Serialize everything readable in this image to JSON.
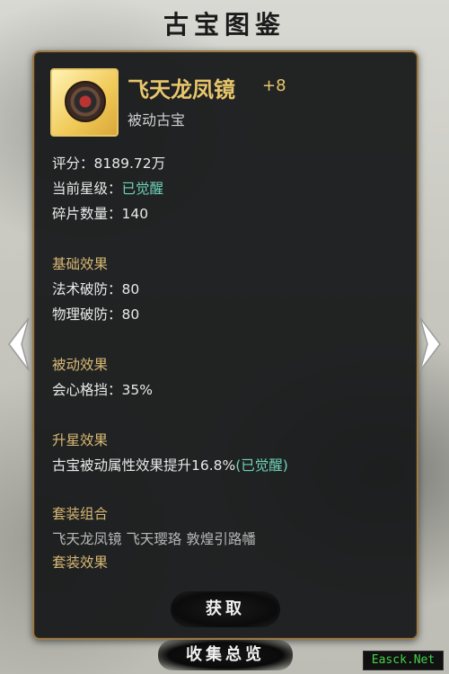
{
  "header": {
    "title": "古宝图鉴"
  },
  "item": {
    "name": "飞天龙凤镜",
    "level": "+8",
    "type": "被动古宝"
  },
  "stats": {
    "rating_label": "评分：",
    "rating_value": "8189.72万",
    "star_label": "当前星级：",
    "star_value": "已觉醒",
    "fragments_label": "碎片数量：",
    "fragments_value": "140"
  },
  "sections": {
    "base_title": "基础效果",
    "base_lines": [
      "法术破防：80",
      "物理破防：80"
    ],
    "passive_title": "被动效果",
    "passive_lines": [
      "会心格挡：35%"
    ],
    "upgrade_title": "升星效果",
    "upgrade_text": "古宝被动属性效果提升16.8%",
    "upgrade_tag": "(已觉醒)",
    "set_title": "套装组合",
    "set_items": "飞天龙凤镜 飞天璎珞 敦煌引路幡",
    "set_effect_title": "套装效果"
  },
  "buttons": {
    "get": "获取",
    "collection_overview": "收集总览"
  },
  "watermark": "Easck.Net",
  "colors": {
    "gold": "#e8c66b",
    "teal": "#6fd3b8",
    "panel": "#16181a"
  }
}
